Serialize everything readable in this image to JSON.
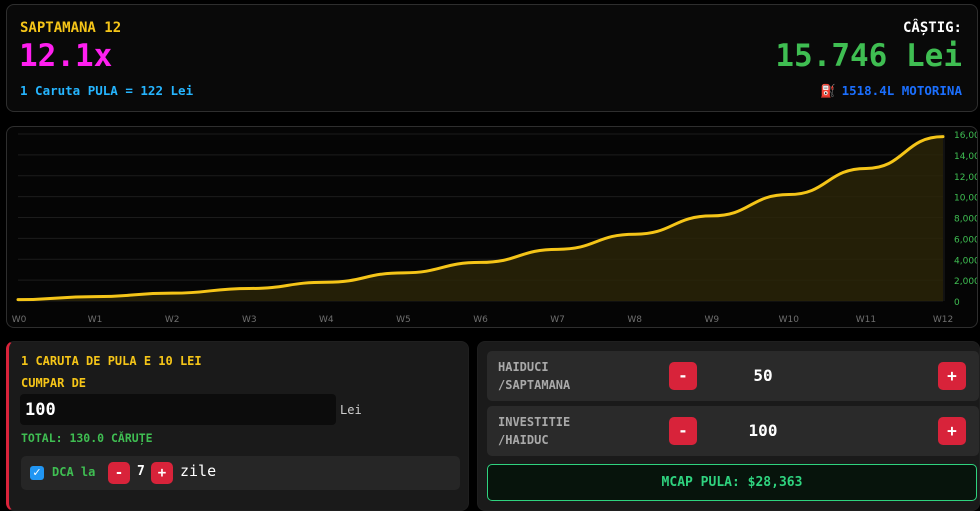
{
  "header": {
    "week_label": "SAPTAMANA 12",
    "multiplier": "12.1x",
    "rate": "1 Caruta PULA = 122 Lei",
    "gain_label": "CÂȘTIG:",
    "gain_value": "15.746 Lei",
    "fuel_icon": "fuel-pump-icon",
    "fuel": "1518.4L MOTORINA"
  },
  "chart_data": {
    "type": "area",
    "categories": [
      "W0",
      "W1",
      "W2",
      "W3",
      "W4",
      "W5",
      "W6",
      "W7",
      "W8",
      "W9",
      "W10",
      "W11",
      "W12"
    ],
    "values": [
      130,
      420,
      750,
      1200,
      1800,
      2700,
      3700,
      4950,
      6400,
      8150,
      10200,
      12700,
      15746
    ],
    "ylim": [
      0,
      16000
    ],
    "yticks": [
      "16,000",
      "14,000",
      "12,000",
      "10,000",
      "8,000",
      "6,000",
      "4,000",
      "2,000",
      "0"
    ],
    "grid": true,
    "line_color": "#f5c518",
    "fill_color": "#2a2408",
    "tick_color_y": "#3fbe52",
    "tick_color_x": "#6f6f6f"
  },
  "buy": {
    "title": "1 CARUTA DE PULA E 10 LEI",
    "subtitle": "CUMPAR DE",
    "amount": "100",
    "unit": "Lei",
    "total": "TOTAL: 130.0 CĂRUȚE",
    "dca_checked": true,
    "dca_label": "DCA la",
    "minus": "-",
    "plus": "+",
    "dca_days": "7",
    "dca_unit": "zile"
  },
  "controls": {
    "rows": [
      {
        "label1": "HAIDUCI",
        "label2": "/SAPTAMANA",
        "minus": "-",
        "value": "50",
        "plus": "+"
      },
      {
        "label1": "INVESTITIE",
        "label2": "/HAIDUC",
        "minus": "-",
        "value": "100",
        "plus": "+"
      }
    ],
    "mcap": "MCAP PULA: $28,363"
  }
}
